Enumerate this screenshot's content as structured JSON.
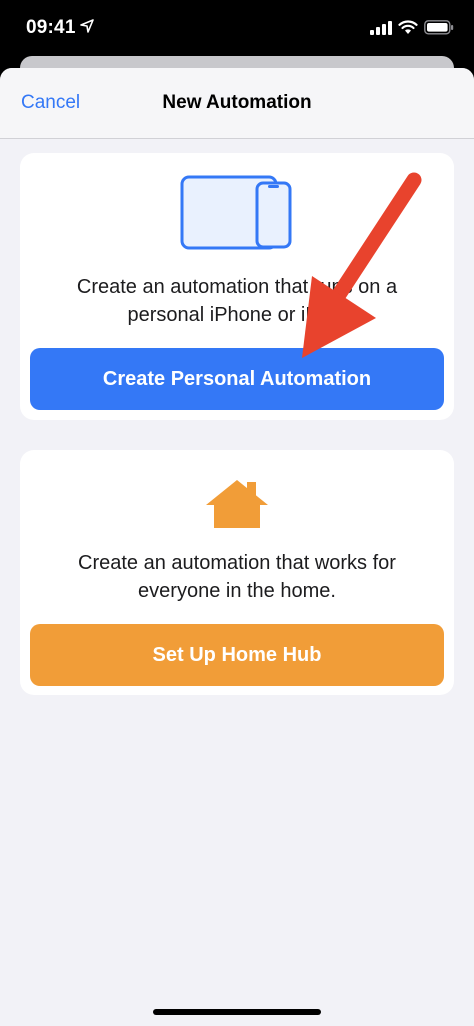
{
  "status_bar": {
    "time": "09:41"
  },
  "nav": {
    "cancel_label": "Cancel",
    "title": "New Automation"
  },
  "personal_card": {
    "description": "Create an automation that runs on a personal iPhone or iPad.",
    "description_line1": "Create an automation that runs on a",
    "description_line2": "personal iPhone or iPad.",
    "button_label": "Create Personal Automation",
    "icon": "iphone-ipad-icon",
    "button_color": "#3478F6"
  },
  "home_card": {
    "description_line1": "Create an automation that works for",
    "description_line2": "everyone in the home.",
    "button_label": "Set Up Home Hub",
    "icon": "home-icon",
    "button_color": "#F19D38"
  },
  "colors": {
    "accent": "#3478F6",
    "home": "#F19D38",
    "annotation_arrow": "#E8432D"
  }
}
